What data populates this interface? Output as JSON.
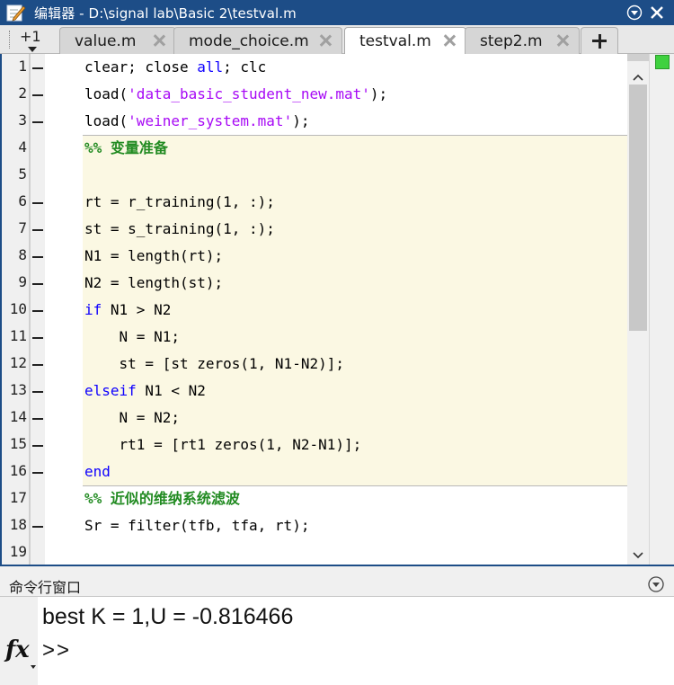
{
  "window": {
    "title": "编辑器 - D:\\signal lab\\Basic 2\\testval.m"
  },
  "tabs": {
    "overflow_count": "+1",
    "items": [
      {
        "label": "value.m",
        "active": false
      },
      {
        "label": "mode_choice.m",
        "active": false
      },
      {
        "label": "testval.m",
        "active": true
      },
      {
        "label": "step2.m",
        "active": false
      }
    ]
  },
  "editor": {
    "lines": [
      {
        "n": "1",
        "mark": true
      },
      {
        "n": "2",
        "mark": true
      },
      {
        "n": "3",
        "mark": true
      },
      {
        "n": "4",
        "mark": false
      },
      {
        "n": "5",
        "mark": false
      },
      {
        "n": "6",
        "mark": true
      },
      {
        "n": "7",
        "mark": true
      },
      {
        "n": "8",
        "mark": true
      },
      {
        "n": "9",
        "mark": true
      },
      {
        "n": "10",
        "mark": true
      },
      {
        "n": "11",
        "mark": true
      },
      {
        "n": "12",
        "mark": true
      },
      {
        "n": "13",
        "mark": true
      },
      {
        "n": "14",
        "mark": true
      },
      {
        "n": "15",
        "mark": true
      },
      {
        "n": "16",
        "mark": true
      },
      {
        "n": "17",
        "mark": false
      },
      {
        "n": "18",
        "mark": true
      },
      {
        "n": "19",
        "mark": false
      }
    ],
    "code": {
      "l1a": "clear; close ",
      "l1kw": "all",
      "l1b": "; clc",
      "l2a": "load(",
      "l2s": "'data_basic_student_new.mat'",
      "l2b": ");",
      "l3a": "load(",
      "l3s": "'weiner_system.mat'",
      "l3b": ");",
      "l4": "%% 变量准备",
      "l6": "rt = r_training(1, :);",
      "l7": "st = s_training(1, :);",
      "l8": "N1 = length(rt);",
      "l9": "N2 = length(st);",
      "l10kw": "if",
      "l10b": " N1 > N2",
      "l11": "    N = N1;",
      "l12": "    st = [st zeros(1, N1-N2)];",
      "l13kw": "elseif",
      "l13b": " N1 < N2",
      "l14": "    N = N2;",
      "l15": "    rt1 = [rt1 zeros(1, N2-N1)];",
      "l16kw": "end",
      "l17": "%% 近似的维纳系统滤波",
      "l18": "Sr = filter(tfb, tfa, rt);"
    }
  },
  "command_window": {
    "title": "命令行窗口",
    "output": "best K = 1,U = -0.816466",
    "prompt": ">>"
  },
  "colors": {
    "titlebar": "#1d4d87",
    "keyword": "#0e00ff",
    "string": "#a709f5",
    "comment": "#228b22",
    "cell_background": "#fbf8e3",
    "status_ok": "#3fd13f"
  }
}
